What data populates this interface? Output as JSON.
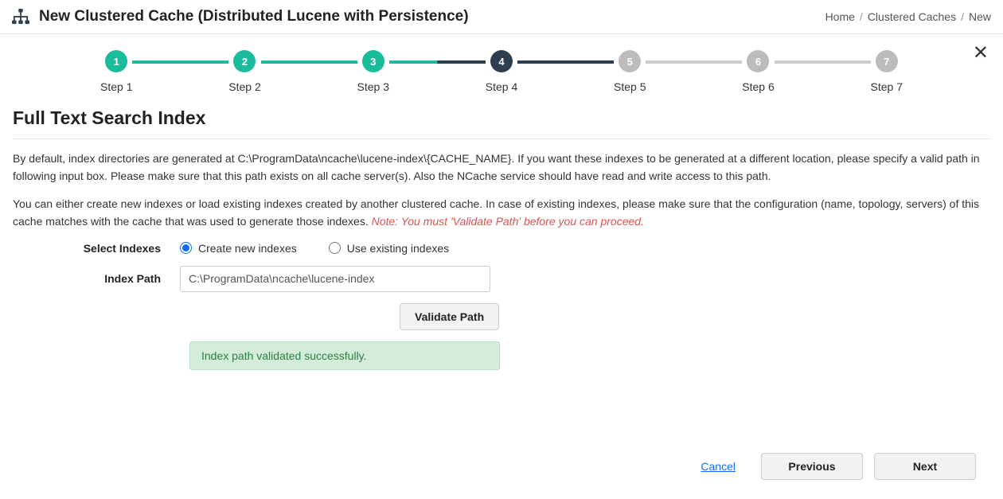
{
  "header": {
    "title": "New Clustered Cache (Distributed Lucene with Persistence)"
  },
  "breadcrumbs": {
    "items": [
      "Home",
      "Clustered Caches",
      "New"
    ],
    "sep": "/"
  },
  "stepper": {
    "steps": [
      {
        "num": "1",
        "label": "Step 1",
        "state": "done"
      },
      {
        "num": "2",
        "label": "Step 2",
        "state": "done"
      },
      {
        "num": "3",
        "label": "Step 3",
        "state": "done"
      },
      {
        "num": "4",
        "label": "Step 4",
        "state": "current"
      },
      {
        "num": "5",
        "label": "Step 5",
        "state": "future"
      },
      {
        "num": "6",
        "label": "Step 6",
        "state": "future"
      },
      {
        "num": "7",
        "label": "Step 7",
        "state": "future"
      }
    ]
  },
  "section": {
    "title": "Full Text Search Index"
  },
  "description": {
    "p1": "By default, index directories are generated at C:\\ProgramData\\ncache\\lucene-index\\{CACHE_NAME}. If you want these indexes to be generated at a different location, please specify a valid path in following input box. Please make sure that this path exists on all cache server(s). Also the NCache service should have read and write access to this path.",
    "p2a": "You can either create new indexes or load existing indexes created by another clustered cache. In case of existing indexes, please make sure that the configuration (name, topology, servers) of this cache matches with the cache that was used to generate those indexes. ",
    "note": "Note: You must 'Validate Path' before you can proceed."
  },
  "form": {
    "select_indexes_label": "Select Indexes",
    "create_new_label": "Create new indexes",
    "use_existing_label": "Use existing indexes",
    "index_path_label": "Index Path",
    "index_path_value": "C:\\ProgramData\\ncache\\lucene-index",
    "validate_button": "Validate Path",
    "success_message": "Index path validated successfully."
  },
  "footer": {
    "cancel": "Cancel",
    "previous": "Previous",
    "next": "Next"
  }
}
